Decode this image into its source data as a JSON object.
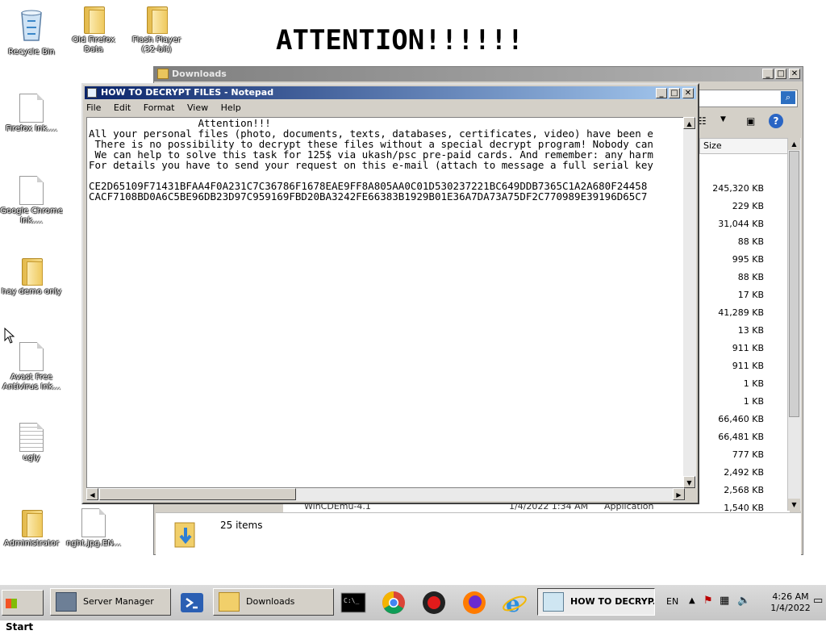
{
  "desktop": {
    "banner": "ATTENTION!!!!!!",
    "icons": [
      {
        "label": "Recycle Bin"
      },
      {
        "label": "Old Firefox Data"
      },
      {
        "label": "Flash Player (32-bit)"
      },
      {
        "label": "Firefox Ink...."
      },
      {
        "label": "Google Chrome Ink...."
      },
      {
        "label": "hay demo only"
      },
      {
        "label": "Avast Free Antivirus Ink..."
      },
      {
        "label": "ugly"
      },
      {
        "label": "Administrator"
      },
      {
        "label": "nght.jpg.EN..."
      }
    ]
  },
  "explorer": {
    "title": "Downloads",
    "column_size": "Size",
    "sizes": [
      "245,320 KB",
      "229 KB",
      "31,044 KB",
      "88 KB",
      "995 KB",
      "88 KB",
      "17 KB",
      "41,289 KB",
      "13 KB",
      "911 KB",
      "911 KB",
      "1 KB",
      "1 KB",
      "66,460 KB",
      "66,481 KB",
      "777 KB",
      "2,492 KB",
      "2,568 KB",
      "1,540 KB"
    ],
    "last_row": {
      "name": "WinCDEmu-4.1",
      "date": "1/4/2022 1:34 AM",
      "type": "Application"
    },
    "item_count": "25 items"
  },
  "notepad": {
    "title": "HOW TO DECRYPT FILES - Notepad",
    "menu": [
      "File",
      "Edit",
      "Format",
      "View",
      "Help"
    ],
    "text": "                  Attention!!!\nAll your personal files (photo, documents, texts, databases, certificates, video) have been e\n There is no possibility to decrypt these files without a special decrypt program! Nobody can\n We can help to solve this task for 125$ via ukash/psc pre-paid cards. And remember: any harm\nFor details you have to send your request on this e-mail (attach to message a full serial key\n\nCE2D65109F71431BFAA4F0A231C7C36786F1678EAE9FF8A805AA0C01D530237221BC649DDB7365C1A2A680F24458\nCACF7108BD0A6C5BE96DB23D97C959169FBD20BA3242FE66383B1929B01E36A7DA73A75DF2C770989E39196D65C7"
  },
  "taskbar": {
    "start": "Start",
    "buttons": [
      {
        "label": "Server Manager"
      },
      {
        "label": "Downloads"
      },
      {
        "label": "HOW TO DECRYP..."
      }
    ],
    "lang": "EN",
    "time": "4:26 AM",
    "date": "1/4/2022"
  }
}
